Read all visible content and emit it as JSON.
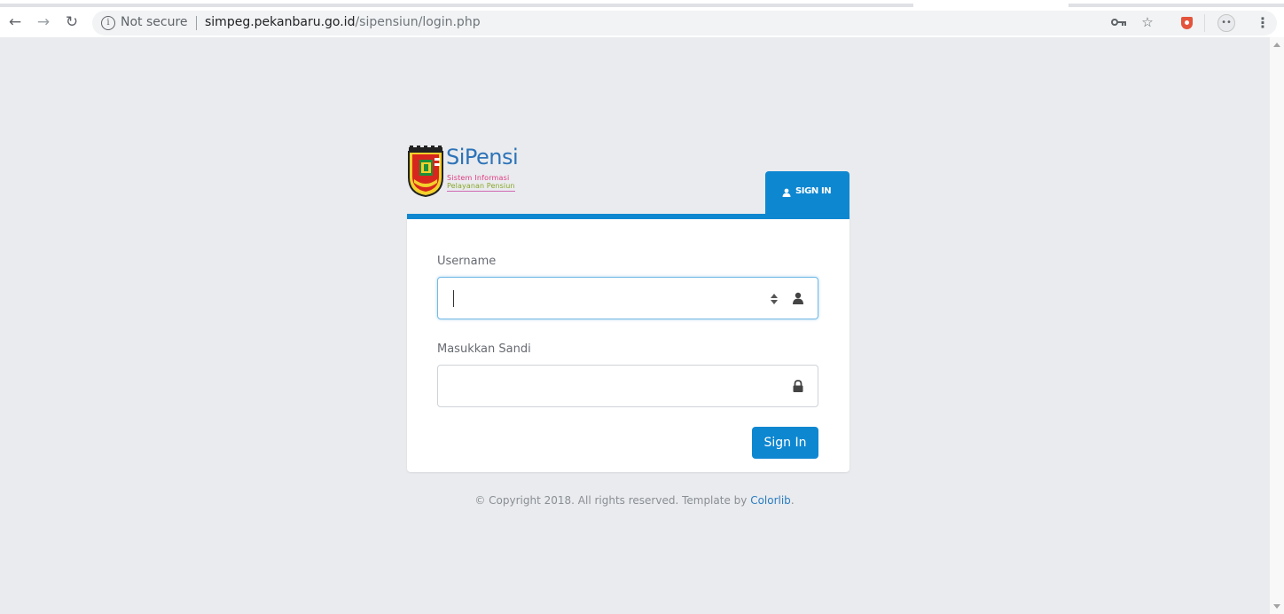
{
  "browser": {
    "security_label": "Not secure",
    "url_host": "simpeg.pekanbaru.go.id",
    "url_path": "/sipensiun/login.php",
    "icons": [
      "back-icon",
      "forward-icon",
      "reload-icon",
      "info-icon",
      "key-icon",
      "star-icon",
      "shield-extension-icon",
      "profile-extension-icon",
      "menu-icon"
    ]
  },
  "logo": {
    "title": "SiPensi",
    "subtitle_line1": "Sistem Informasi",
    "subtitle_line2": "Pelayanan Pensiun"
  },
  "tab": {
    "label": "SIGN IN",
    "icon": "user-icon"
  },
  "form": {
    "username": {
      "label": "Username",
      "value": "",
      "placeholder": "",
      "icon": "user-icon"
    },
    "password": {
      "label": "Masukkan Sandi",
      "value": "",
      "placeholder": "",
      "icon": "lock-icon"
    },
    "submit_label": "Sign In"
  },
  "footer": {
    "text": "© Copyright 2018. All rights reserved. Template by ",
    "link_text": "Colorlib",
    "suffix": "."
  },
  "colors": {
    "accent": "#0e87d1",
    "background": "#e9ebee",
    "card": "#ffffff",
    "logo_blue": "#2d73b8"
  }
}
